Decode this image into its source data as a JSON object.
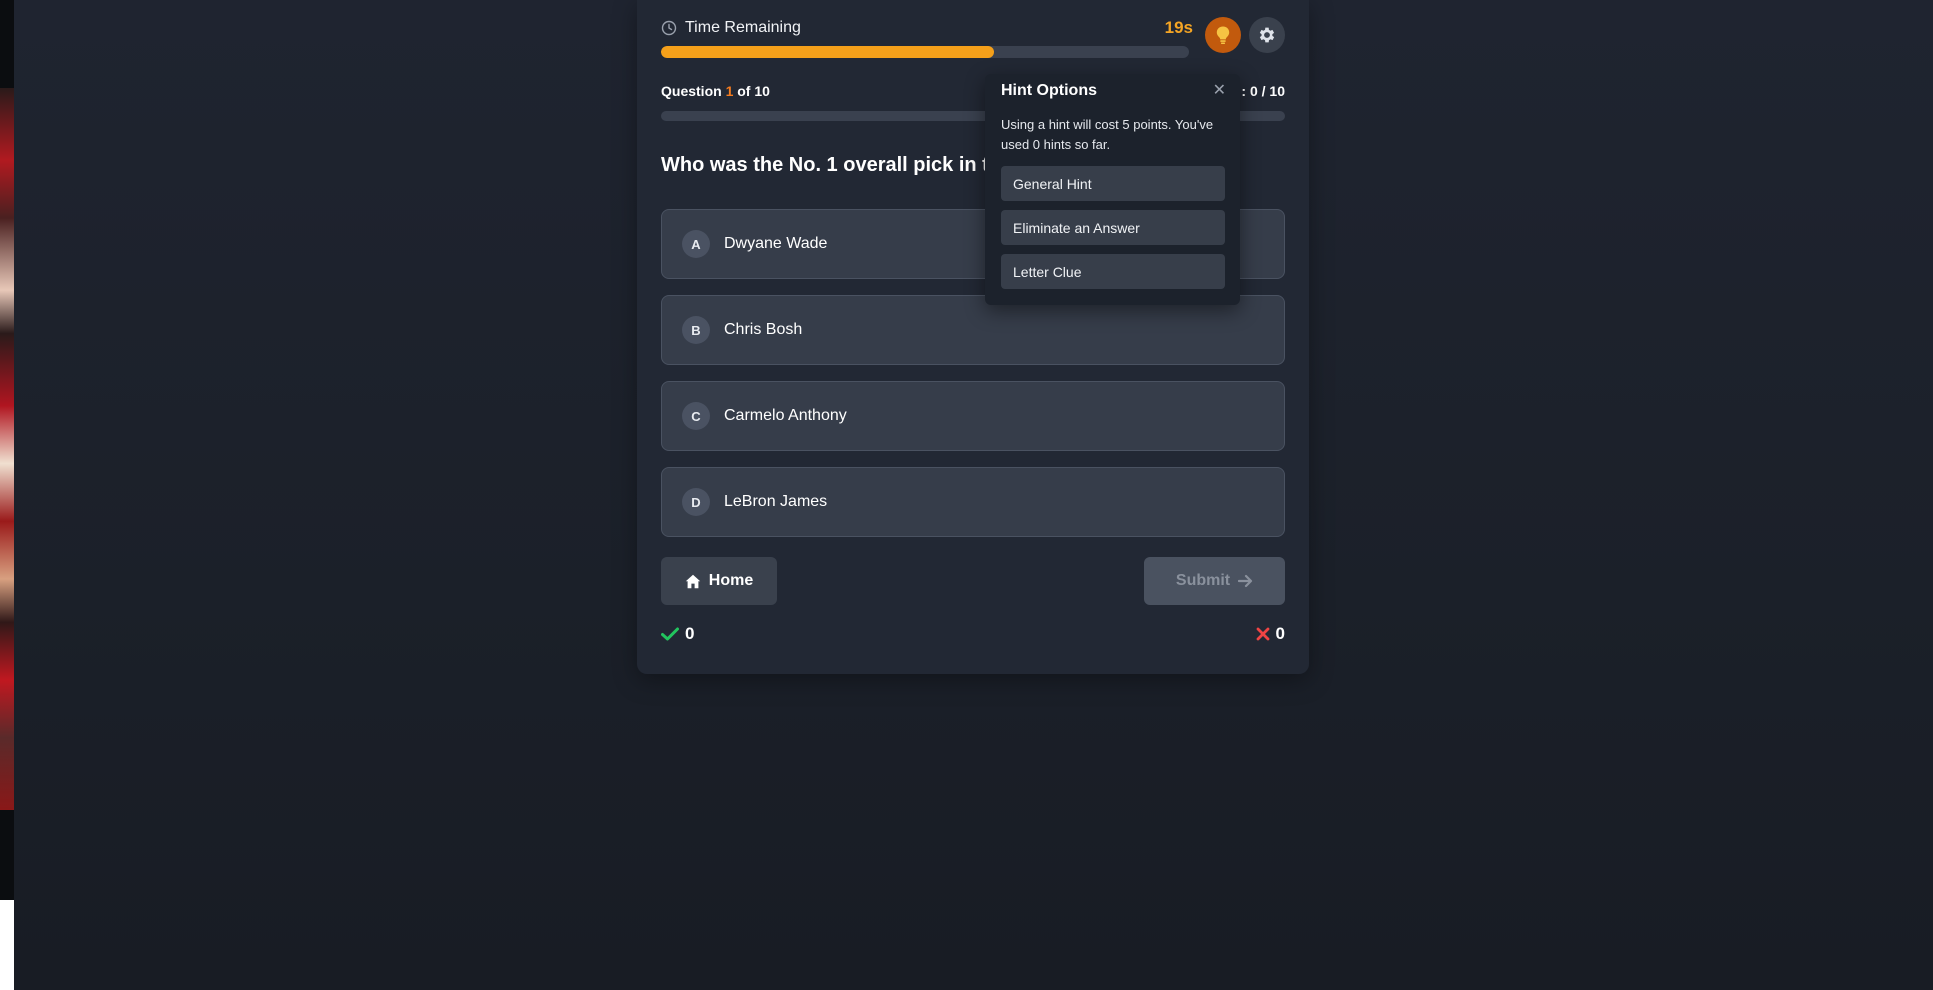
{
  "timer": {
    "label": "Time Remaining",
    "value": "19s",
    "fraction_remaining": 0.63
  },
  "question_meta": {
    "prefix": "Question",
    "current": "1",
    "middle": "of",
    "total": "10"
  },
  "score_meta": {
    "text": ": 0 / 10"
  },
  "question": {
    "text": "Who was the No. 1 overall pick in th"
  },
  "options": [
    {
      "letter": "A",
      "text": "Dwyane Wade"
    },
    {
      "letter": "B",
      "text": "Chris Bosh"
    },
    {
      "letter": "C",
      "text": "Carmelo Anthony"
    },
    {
      "letter": "D",
      "text": "LeBron James"
    }
  ],
  "actions": {
    "home_label": "Home",
    "submit_label": "Submit"
  },
  "tally": {
    "correct": "0",
    "wrong": "0"
  },
  "hint_popup": {
    "title": "Hint Options",
    "close_glyph": "✕",
    "description": "Using a hint will cost 5 points. You've used 0 hints so far.",
    "options": [
      "General Hint",
      "Eliminate an Answer",
      "Letter Clue"
    ]
  },
  "colors": {
    "accent_orange": "#f5a01a",
    "hint_button": "#c25a0d",
    "correct_green": "#22c55e",
    "wrong_red": "#ef4444"
  },
  "icons": {
    "timer": "clock-icon",
    "hint": "lightbulb-icon",
    "settings": "gear-icon",
    "home": "home-icon",
    "submit": "arrow-right-icon",
    "correct": "check-icon",
    "wrong": "x-icon",
    "close": "close-icon"
  }
}
